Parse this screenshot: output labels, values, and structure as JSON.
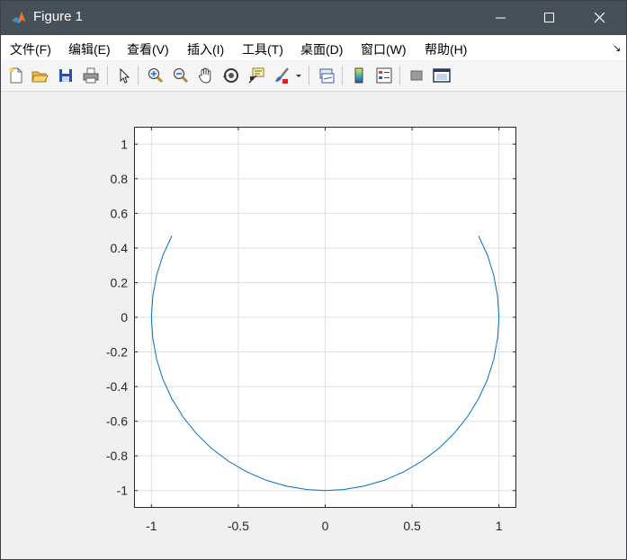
{
  "window": {
    "title": "Figure 1"
  },
  "menu": {
    "items": [
      {
        "id": "file",
        "label": "文件(F)"
      },
      {
        "id": "edit",
        "label": "编辑(E)"
      },
      {
        "id": "view",
        "label": "查看(V)"
      },
      {
        "id": "insert",
        "label": "插入(I)"
      },
      {
        "id": "tools",
        "label": "工具(T)"
      },
      {
        "id": "desktop",
        "label": "桌面(D)"
      },
      {
        "id": "window",
        "label": "窗口(W)"
      },
      {
        "id": "help",
        "label": "帮助(H)"
      }
    ],
    "dock_arrow": "↘"
  },
  "toolbar": {
    "buttons": [
      "new-figure-icon",
      "open-file-icon",
      "save-icon",
      "print-icon",
      "edit-plot-icon",
      "zoom-in-icon",
      "zoom-out-icon",
      "pan-icon",
      "rotate-3d-icon",
      "data-cursor-icon",
      "brush-icon",
      "brush-dropdown-icon",
      "link-plot-icon",
      "colorbar-icon",
      "legend-icon",
      "hide-plot-tools-icon",
      "show-plot-tools-icon"
    ]
  },
  "colors": {
    "titlebar": "#465059",
    "series": "#0072bd",
    "grid": "#dfdfdf"
  },
  "chart_data": {
    "type": "line",
    "title": "",
    "xlabel": "",
    "ylabel": "",
    "xlim": [
      -1.1,
      1.1
    ],
    "ylim": [
      -1.1,
      1.1
    ],
    "grid": true,
    "xticks": [
      -1,
      -0.5,
      0,
      0.5,
      1
    ],
    "xtick_labels": [
      "-1",
      "-0.5",
      "0",
      "0.5",
      "1"
    ],
    "yticks": [
      1,
      0.8,
      0.6,
      0.4,
      0.2,
      0,
      -0.2,
      -0.4,
      -0.6,
      -0.8,
      -1
    ],
    "ytick_labels": [
      "1",
      "0.8",
      "0.6",
      "0.4",
      "0.2",
      "0",
      "-0.2",
      "-0.4",
      "-0.6",
      "-0.8",
      "-1"
    ],
    "series": [
      {
        "x": [
          -0.883,
          -0.934,
          -0.97,
          -0.992,
          -1.0,
          -0.992,
          -0.97,
          -0.934,
          -0.883,
          -0.819,
          -0.743,
          -0.656,
          -0.559,
          -0.454,
          -0.342,
          -0.225,
          -0.105,
          0.0,
          0.105,
          0.225,
          0.342,
          0.454,
          0.559,
          0.656,
          0.743,
          0.819,
          0.883,
          0.934,
          0.97,
          0.992,
          1.0,
          0.992,
          0.97,
          0.934,
          0.883
        ],
        "y": [
          0.469,
          0.358,
          0.242,
          0.122,
          0.0,
          -0.122,
          -0.242,
          -0.358,
          -0.469,
          -0.574,
          -0.669,
          -0.755,
          -0.829,
          -0.891,
          -0.94,
          -0.974,
          -0.994,
          -1.0,
          -0.994,
          -0.974,
          -0.94,
          -0.891,
          -0.829,
          -0.755,
          -0.669,
          -0.574,
          -0.469,
          -0.358,
          -0.242,
          -0.122,
          0.0,
          0.122,
          0.242,
          0.358,
          0.469
        ]
      }
    ]
  }
}
